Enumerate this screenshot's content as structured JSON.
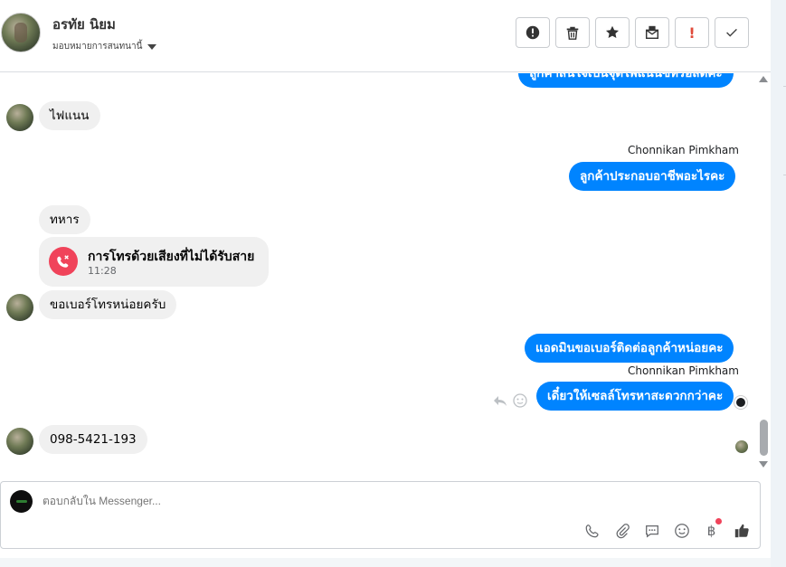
{
  "header": {
    "name": "อรทัย นิยม",
    "assign_label": "มอบหมายการสนทนานี้",
    "actions": [
      {
        "name": "report-button",
        "icon": "alert-circle-icon"
      },
      {
        "name": "delete-button",
        "icon": "trash-icon"
      },
      {
        "name": "star-button",
        "icon": "star-icon"
      },
      {
        "name": "mark-unread-button",
        "icon": "envelope-icon"
      },
      {
        "name": "spam-button",
        "icon": "exclamation-icon",
        "glyph": "!"
      },
      {
        "name": "done-button",
        "icon": "check-icon"
      }
    ]
  },
  "thread": {
    "top_partial": "ลูกค้าสนใจเป็นจุดไพแนนซ์หรือสดคะ",
    "messages": [
      {
        "dir": "in",
        "text": "ไฟแนน"
      },
      {
        "dir": "out",
        "sender": "Chonnikan Pimkham",
        "text": "ลูกค้าประกอบอาชีพอะไรคะ"
      },
      {
        "dir": "in",
        "text": "ทหาร"
      },
      {
        "dir": "in",
        "text": "ขอเบอร์โทรหน่อยครับ"
      },
      {
        "dir": "out",
        "text": "แอดมินขอเบอร์ติดต่อลูกค้าหน่อยคะ"
      },
      {
        "dir": "out",
        "sender": "Chonnikan Pimkham",
        "text": "เดี๋ยวให้เซลล์โทรหาสะดวกกว่าคะ"
      },
      {
        "dir": "in",
        "text": "098-5421-193"
      }
    ],
    "missed_call": {
      "title": "การโทรด้วยเสียงที่ไม่ได้รับสาย",
      "time": "11:28"
    }
  },
  "composer": {
    "placeholder": "ตอบกลับใน Messenger...",
    "currency_glyph": "฿"
  },
  "colors": {
    "outgoing": "#0084ff",
    "incoming": "#f0f0f0",
    "missed_call": "#f0435a"
  }
}
